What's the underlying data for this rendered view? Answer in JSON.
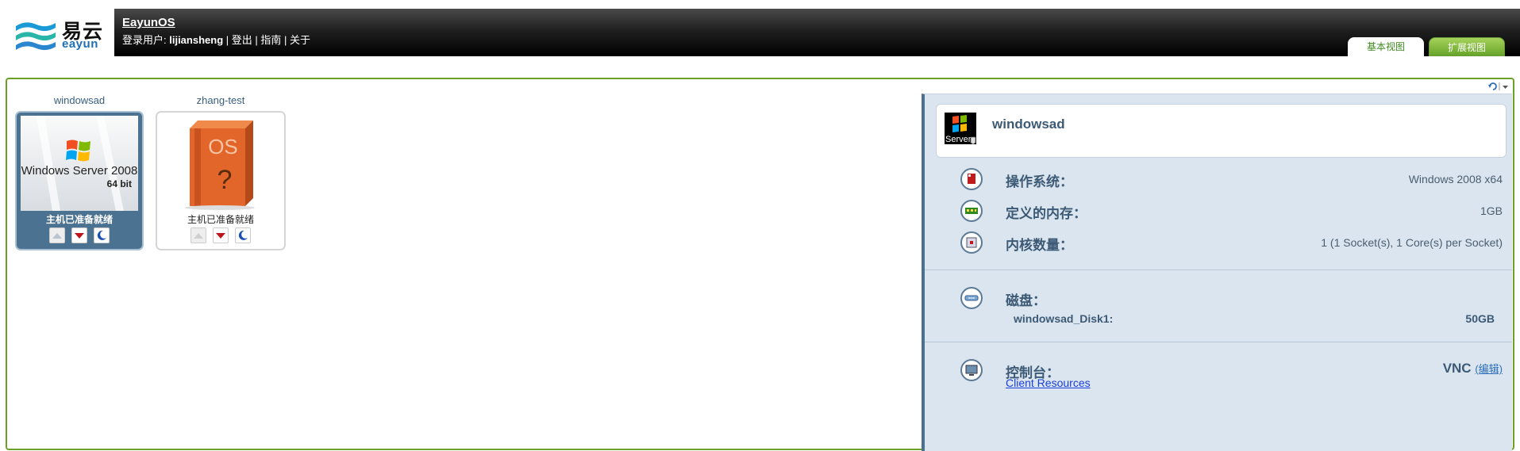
{
  "brand": {
    "cn": "易云",
    "en": "eayun"
  },
  "header": {
    "app_title": "EayunOS",
    "user_prefix": "登录用户: ",
    "username": "lijiansheng",
    "sep1": " | ",
    "logout": "登出",
    "sep2": " | ",
    "guide": "指南",
    "sep3": " | ",
    "about": "关于"
  },
  "tabs": [
    {
      "label": "基本视图",
      "active": true
    },
    {
      "label": "扩展视图",
      "active": false
    }
  ],
  "vms": [
    {
      "name": "windowsad",
      "status": "主机已准备就绪",
      "selected": true,
      "image_text": "Windows Server 2008",
      "image_bits": "64 bit"
    },
    {
      "name": "zhang-test",
      "status": "主机已准备就绪",
      "selected": false,
      "image_text": "OS"
    }
  ],
  "detail": {
    "name": "windowsad",
    "thumb_text": "Server",
    "os_label": "操作系统：",
    "os_value": "Windows 2008 x64",
    "mem_label": "定义的内存：",
    "mem_value": "1GB",
    "cores_label": "内核数量：",
    "cores_value": "1 (1 Socket(s), 1 Core(s) per Socket)",
    "disk_label": "磁盘：",
    "disk_name": "windowsad_Disk1:",
    "disk_size": "50GB",
    "console_label": "控制台：",
    "console_value": "VNC",
    "console_edit": "(编辑)",
    "client_resources": "Client Resources"
  },
  "colors": {
    "accent_green": "#6ca128",
    "panel_bg": "#dbe5ef",
    "panel_text": "#3c5a75",
    "selected_card": "#4b7291"
  }
}
